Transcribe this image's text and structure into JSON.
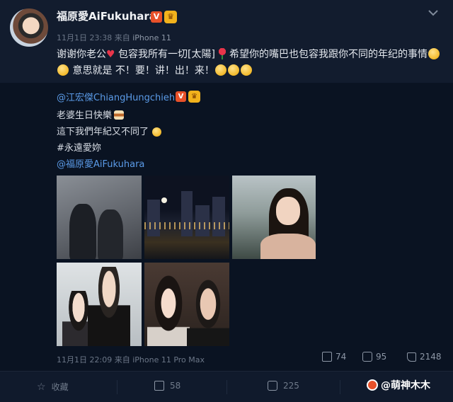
{
  "post": {
    "username": "福原愛AiFukuhara",
    "verified_badge": "V",
    "crown_icon": "crown-icon",
    "time": "11月1日 23:38",
    "source_prefix": "来自",
    "source": "iPhone 11",
    "text_parts": {
      "p1": "谢谢你老公",
      "p2": "包容我所有一切[太陽]",
      "p3": "希望你的嘴巴也包容我跟你不同的年纪的事情",
      "p4": "意思就是 不！要！讲！出！来！"
    },
    "heart": "♥"
  },
  "repost": {
    "username": "@江宏傑ChiangHungchieh",
    "verified_badge": "V",
    "lines": {
      "l1": "老婆生日快樂",
      "l2": "這下我們年紀又不同了",
      "l3": "#永遠愛妳",
      "l4": "@福原愛AiFukuhara"
    },
    "time": "11月1日 22:09",
    "source_prefix": "来自",
    "source": "iPhone 11 Pro Max",
    "stats": {
      "reposts": "74",
      "comments": "95",
      "likes": "2148"
    }
  },
  "bottom_bar": {
    "favorite": "收藏",
    "repost_count": "58",
    "comment_count": "225"
  },
  "watermark": {
    "text": "@萌神木木"
  },
  "colors": {
    "background": "#0c1526",
    "link": "#5b9be8",
    "vip_orange": "#e8512a",
    "crown_gold": "#f2b21c"
  }
}
